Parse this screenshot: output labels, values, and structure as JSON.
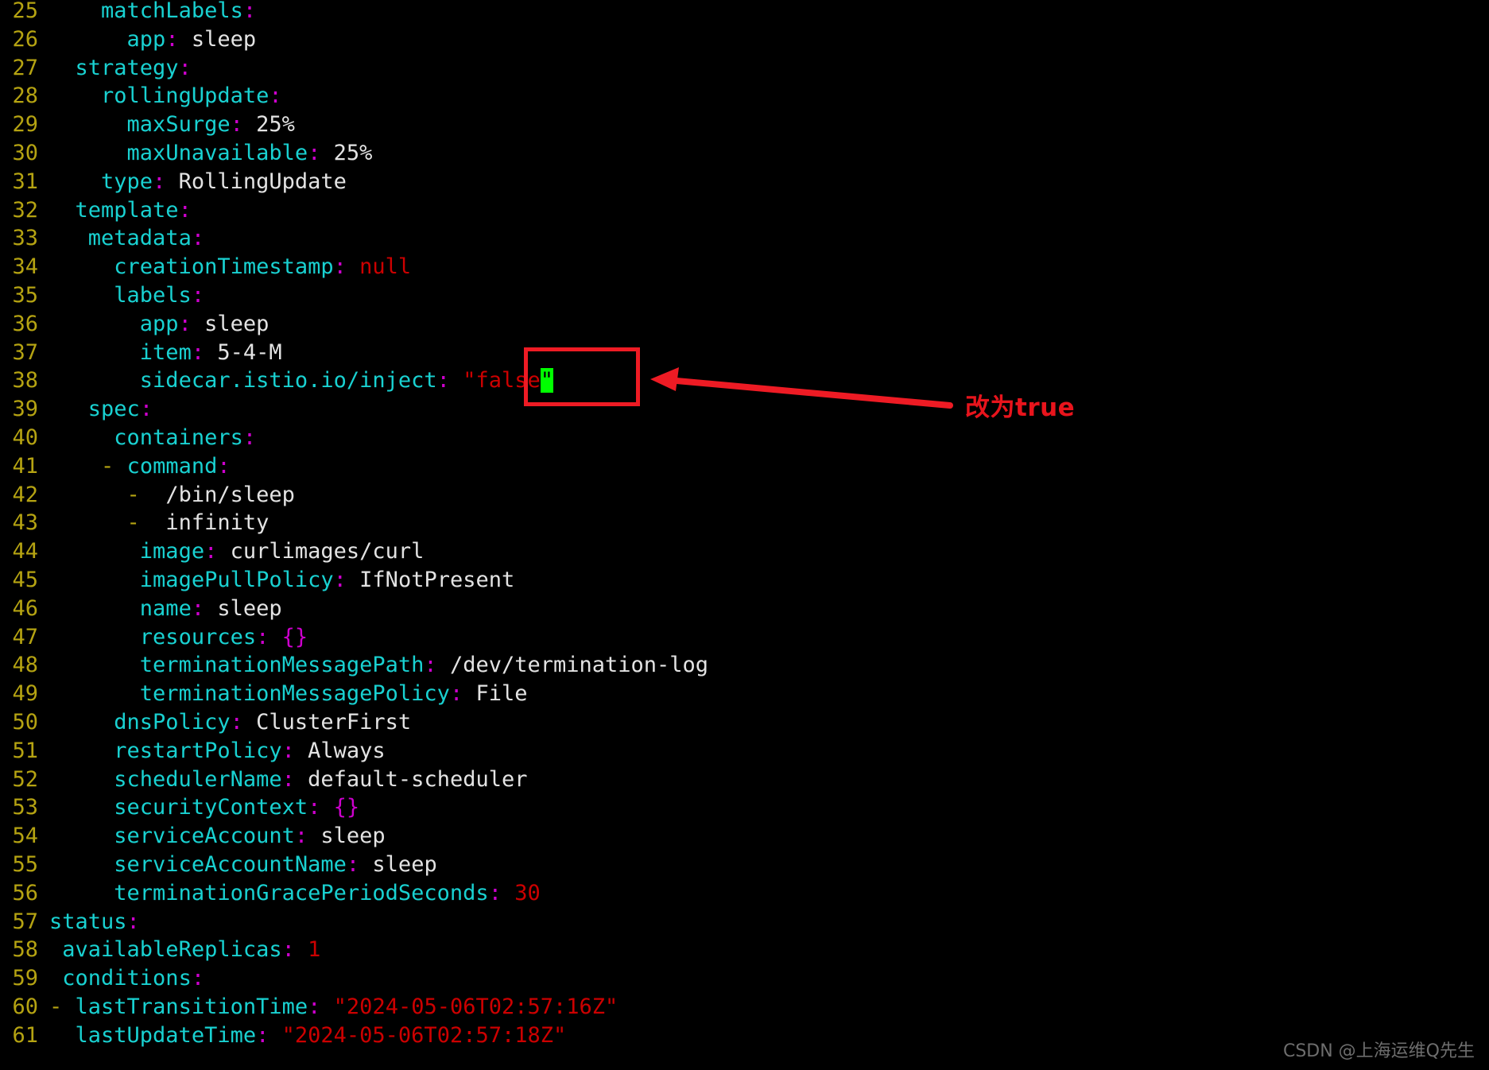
{
  "editor": {
    "type": "terminal-yaml-editor",
    "background": "#000000",
    "colors": {
      "line_number": "#b5a312",
      "key": "#19d1d1",
      "punctuation": "#cd00cd",
      "value": "#e3e3e3",
      "literal": "#cc0000",
      "cursor_background": "#00ff00",
      "annotation": "#ee1b24"
    },
    "first_line_number": 25,
    "last_line_number": 61,
    "lines": [
      {
        "num": "25",
        "indent": 4,
        "key": "matchLabels",
        "colon": ":",
        "value": "",
        "vtype": ""
      },
      {
        "num": "26",
        "indent": 6,
        "key": "app",
        "colon": ":",
        "value": "sleep",
        "vtype": "plain"
      },
      {
        "num": "27",
        "indent": 2,
        "key": "strategy",
        "colon": ":",
        "value": "",
        "vtype": ""
      },
      {
        "num": "28",
        "indent": 4,
        "key": "rollingUpdate",
        "colon": ":",
        "value": "",
        "vtype": ""
      },
      {
        "num": "29",
        "indent": 6,
        "key": "maxSurge",
        "colon": ":",
        "value": "25%",
        "vtype": "plain"
      },
      {
        "num": "30",
        "indent": 6,
        "key": "maxUnavailable",
        "colon": ":",
        "value": "25%",
        "vtype": "plain"
      },
      {
        "num": "31",
        "indent": 4,
        "key": "type",
        "colon": ":",
        "value": "RollingUpdate",
        "vtype": "plain"
      },
      {
        "num": "32",
        "indent": 2,
        "key": "template",
        "colon": ":",
        "value": "",
        "vtype": ""
      },
      {
        "num": "33",
        "indent": 3,
        "key": "metadata",
        "colon": ":",
        "value": "",
        "vtype": ""
      },
      {
        "num": "34",
        "indent": 5,
        "key": "creationTimestamp",
        "colon": ":",
        "value": "null",
        "vtype": "literal"
      },
      {
        "num": "35",
        "indent": 5,
        "key": "labels",
        "colon": ":",
        "value": "",
        "vtype": ""
      },
      {
        "num": "36",
        "indent": 7,
        "key": "app",
        "colon": ":",
        "value": "sleep",
        "vtype": "plain"
      },
      {
        "num": "37",
        "indent": 7,
        "key": "item",
        "colon": ":",
        "value": "5-4-M",
        "vtype": "plain"
      },
      {
        "num": "38",
        "indent": 7,
        "key": "sidecar.istio.io/inject",
        "colon": ":",
        "value": "\"false\"",
        "vtype": "cursor-literal",
        "cursor_char": "\""
      },
      {
        "num": "39",
        "indent": 3,
        "key": "spec",
        "colon": ":",
        "value": "",
        "vtype": ""
      },
      {
        "num": "40",
        "indent": 5,
        "key": "containers",
        "colon": ":",
        "value": "",
        "vtype": ""
      },
      {
        "num": "41",
        "indent": 4,
        "dash": "-",
        "key": "command",
        "colon": ":",
        "value": "",
        "vtype": ""
      },
      {
        "num": "42",
        "indent": 6,
        "dash": "-",
        "key": "",
        "colon": "",
        "value": "/bin/sleep",
        "vtype": "plain"
      },
      {
        "num": "43",
        "indent": 6,
        "dash": "-",
        "key": "",
        "colon": "",
        "value": "infinity",
        "vtype": "plain"
      },
      {
        "num": "44",
        "indent": 7,
        "key": "image",
        "colon": ":",
        "value": "curlimages/curl",
        "vtype": "plain"
      },
      {
        "num": "45",
        "indent": 7,
        "key": "imagePullPolicy",
        "colon": ":",
        "value": "IfNotPresent",
        "vtype": "plain"
      },
      {
        "num": "46",
        "indent": 7,
        "key": "name",
        "colon": ":",
        "value": "sleep",
        "vtype": "plain"
      },
      {
        "num": "47",
        "indent": 7,
        "key": "resources",
        "colon": ":",
        "value": "{}",
        "vtype": "brace"
      },
      {
        "num": "48",
        "indent": 7,
        "key": "terminationMessagePath",
        "colon": ":",
        "value": "/dev/termination-log",
        "vtype": "plain"
      },
      {
        "num": "49",
        "indent": 7,
        "key": "terminationMessagePolicy",
        "colon": ":",
        "value": "File",
        "vtype": "plain"
      },
      {
        "num": "50",
        "indent": 5,
        "key": "dnsPolicy",
        "colon": ":",
        "value": "ClusterFirst",
        "vtype": "plain"
      },
      {
        "num": "51",
        "indent": 5,
        "key": "restartPolicy",
        "colon": ":",
        "value": "Always",
        "vtype": "plain"
      },
      {
        "num": "52",
        "indent": 5,
        "key": "schedulerName",
        "colon": ":",
        "value": "default-scheduler",
        "vtype": "plain"
      },
      {
        "num": "53",
        "indent": 5,
        "key": "securityContext",
        "colon": ":",
        "value": "{}",
        "vtype": "brace"
      },
      {
        "num": "54",
        "indent": 5,
        "key": "serviceAccount",
        "colon": ":",
        "value": "sleep",
        "vtype": "plain"
      },
      {
        "num": "55",
        "indent": 5,
        "key": "serviceAccountName",
        "colon": ":",
        "value": "sleep",
        "vtype": "plain"
      },
      {
        "num": "56",
        "indent": 5,
        "key": "terminationGracePeriodSeconds",
        "colon": ":",
        "value": "30",
        "vtype": "literal"
      },
      {
        "num": "57",
        "indent": 0,
        "key": "status",
        "colon": ":",
        "value": "",
        "vtype": ""
      },
      {
        "num": "58",
        "indent": 1,
        "key": "availableReplicas",
        "colon": ":",
        "value": "1",
        "vtype": "literal"
      },
      {
        "num": "59",
        "indent": 1,
        "key": "conditions",
        "colon": ":",
        "value": "",
        "vtype": ""
      },
      {
        "num": "60",
        "indent": 0,
        "dash": "-",
        "key": "lastTransitionTime",
        "colon": ":",
        "value": "\"2024-05-06T02:57:16Z\"",
        "vtype": "literal"
      },
      {
        "num": "61",
        "indent": 2,
        "key": "lastUpdateTime",
        "colon": ":",
        "value": "\"2024-05-06T02:57:18Z\"",
        "vtype": "literal"
      }
    ]
  },
  "annotation": {
    "highlight_label": "false-value-highlight",
    "text": "改为true",
    "arrow_label": "annotation-arrow"
  },
  "watermark": {
    "text": "CSDN @上海运维Q先生"
  }
}
